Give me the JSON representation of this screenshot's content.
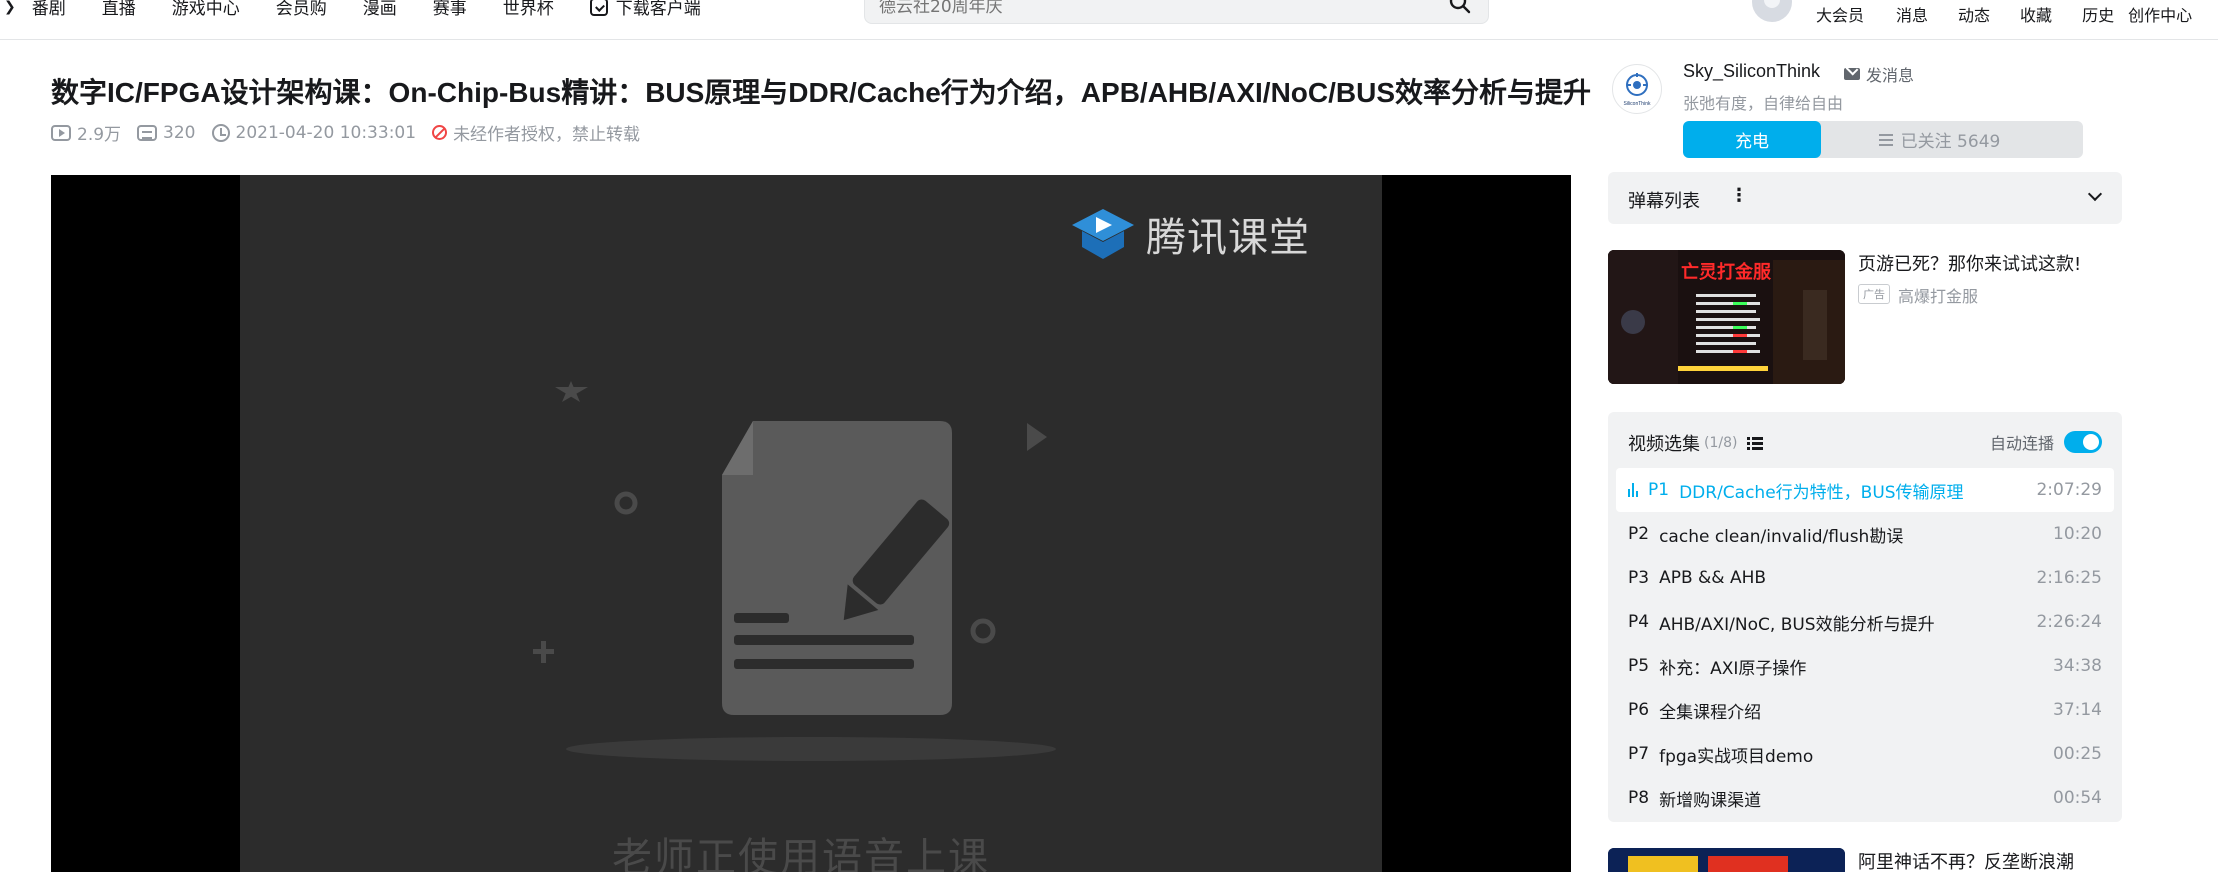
{
  "topnav": {
    "items": [
      "番剧",
      "直播",
      "游戏中心",
      "会员购",
      "漫画",
      "赛事",
      "世界杯",
      "下载客户端"
    ]
  },
  "search": {
    "placeholder": "德云社20周年庆"
  },
  "right_nav": {
    "items": [
      "大会员",
      "消息",
      "动态",
      "收藏",
      "历史",
      "创作中心"
    ]
  },
  "video": {
    "title": "数字IC/FPGA设计架构课：On-Chip-Bus精讲：BUS原理与DDR/Cache行为介绍，APB/AHB/AXI/NoC/BUS效率分析与提升",
    "views": "2.9万",
    "danmaku": "320",
    "date": "2021-04-20 10:33:01",
    "copyright": "未经作者授权，禁止转载"
  },
  "player": {
    "logo_text": "腾讯课堂",
    "overlay_text": "老师正使用语音上课"
  },
  "uploader": {
    "name": "Sky_SiliconThink",
    "message_label": "发消息",
    "description": "张弛有度，自律给自由",
    "charge_label": "充电",
    "follow_label": "已关注 5649",
    "avatar_text": "SiliconThink"
  },
  "danmaku_panel": {
    "title": "弹幕列表"
  },
  "ad": {
    "title": "页游已死？那你来试试这款!",
    "tag": "广告",
    "source": "高爆打金服",
    "thumb_title": "亡灵打金服"
  },
  "episodes": {
    "title": "视频选集",
    "count": "(1/8)",
    "autoplay_label": "自动连播",
    "autoplay_on": true,
    "items": [
      {
        "no": "P1",
        "title": "DDR/Cache行为特性，BUS传输原理",
        "duration": "2:07:29",
        "active": true
      },
      {
        "no": "P2",
        "title": "cache clean/invalid/flush勘误",
        "duration": "10:20",
        "active": false
      },
      {
        "no": "P3",
        "title": "APB && AHB",
        "duration": "2:16:25",
        "active": false
      },
      {
        "no": "P4",
        "title": "AHB/AXI/NoC, BUS效能分析与提升",
        "duration": "2:26:24",
        "active": false
      },
      {
        "no": "P5",
        "title": "补充：AXI原子操作",
        "duration": "34:38",
        "active": false
      },
      {
        "no": "P6",
        "title": "全集课程介绍",
        "duration": "37:14",
        "active": false
      },
      {
        "no": "P7",
        "title": "fpga实战项目demo",
        "duration": "00:25",
        "active": false
      },
      {
        "no": "P8",
        "title": "新增购课渠道",
        "duration": "00:54",
        "active": false
      }
    ]
  },
  "recommend": {
    "title": "阿里神话不再？反垄断浪潮"
  },
  "colors": {
    "accent": "#00aeec",
    "text": "#18191c",
    "muted": "#9499a0",
    "panel": "#f1f2f3"
  }
}
